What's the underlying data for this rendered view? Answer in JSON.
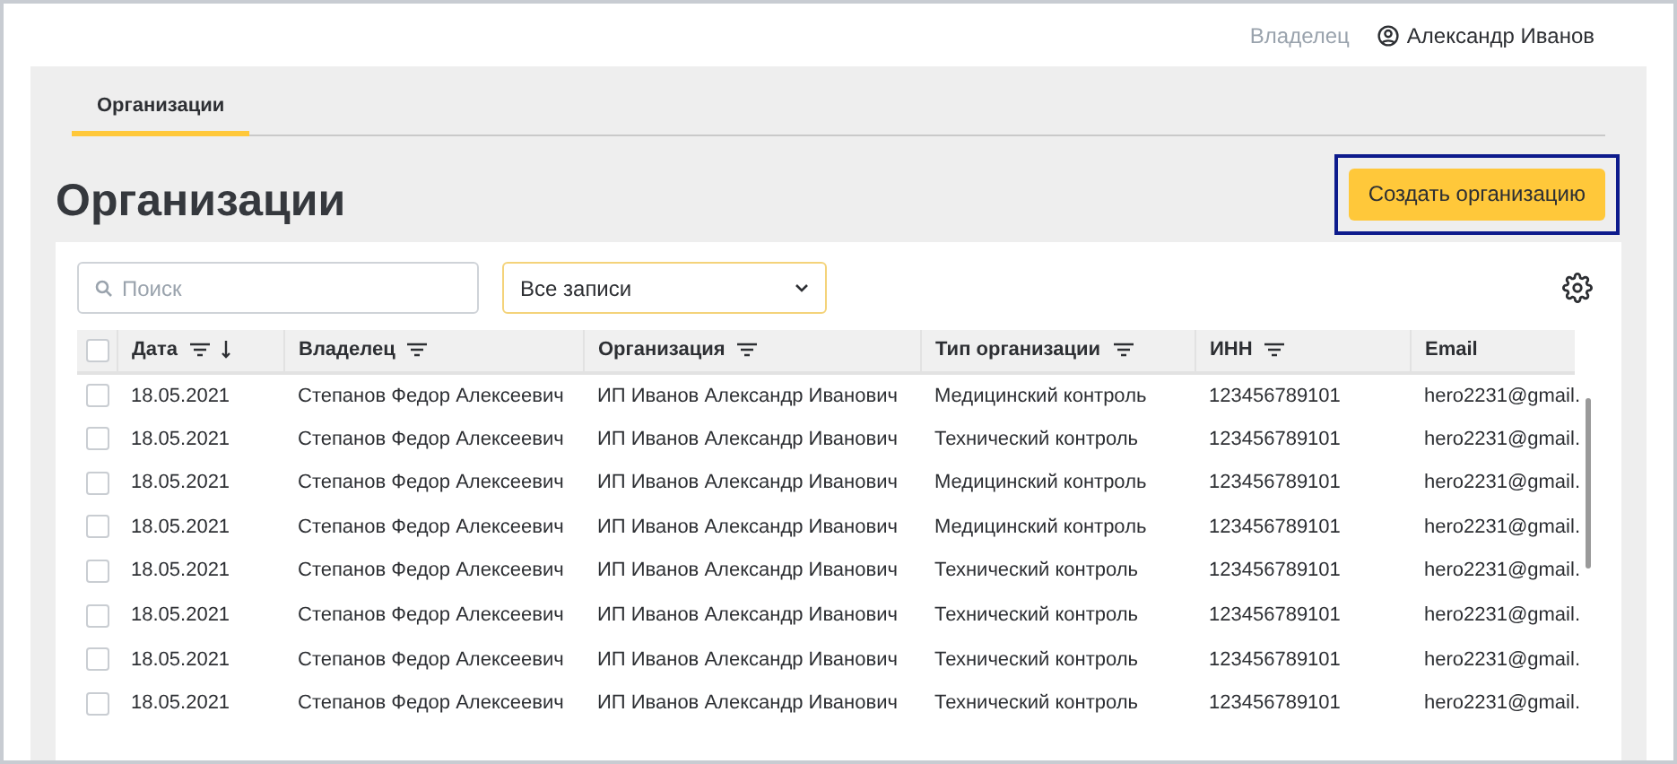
{
  "header": {
    "role": "Владелец",
    "user": "Александр Иванов"
  },
  "tabs": [
    {
      "label": "Организации",
      "selected": true
    }
  ],
  "title": "Организации",
  "create_button": "Создать организацию",
  "search": {
    "placeholder": "Поиск"
  },
  "filter_select": {
    "value": "Все записи"
  },
  "table": {
    "select_all_checked": false,
    "columns": [
      {
        "label": "Дата",
        "filter": true,
        "sorted_descending": true
      },
      {
        "label": "Владелец",
        "filter": true,
        "sorted_descending": false
      },
      {
        "label": "Организация",
        "filter": true,
        "sorted_descending": false
      },
      {
        "label": "Тип организации",
        "filter": true,
        "sorted_descending": false
      },
      {
        "label": "ИНН",
        "filter": true,
        "sorted_descending": false
      },
      {
        "label": "Email",
        "filter": false,
        "sorted_descending": false
      }
    ],
    "rows": [
      {
        "checked": false,
        "cells": [
          "18.05.2021",
          "Степанов Федор Алексеевич",
          "ИП Иванов Александр Иванович",
          "Медицинский контроль",
          "123456789101",
          "hero2231@gmail."
        ]
      },
      {
        "checked": false,
        "cells": [
          "18.05.2021",
          "Степанов Федор Алексеевич",
          "ИП Иванов Александр Иванович",
          "Технический контроль",
          "123456789101",
          "hero2231@gmail."
        ]
      },
      {
        "checked": false,
        "cells": [
          "18.05.2021",
          "Степанов Федор Алексеевич",
          "ИП Иванов Александр Иванович",
          "Медицинский контроль",
          "123456789101",
          "hero2231@gmail."
        ]
      },
      {
        "checked": false,
        "cells": [
          "18.05.2021",
          "Степанов Федор Алексеевич",
          "ИП Иванов Александр Иванович",
          "Медицинский контроль",
          "123456789101",
          "hero2231@gmail."
        ]
      },
      {
        "checked": false,
        "cells": [
          "18.05.2021",
          "Степанов Федор Алексеевич",
          "ИП Иванов Александр Иванович",
          "Технический контроль",
          "123456789101",
          "hero2231@gmail."
        ]
      },
      {
        "checked": false,
        "cells": [
          "18.05.2021",
          "Степанов Федор Алексеевич",
          "ИП Иванов Александр Иванович",
          "Технический контроль",
          "123456789101",
          "hero2231@gmail."
        ]
      },
      {
        "checked": false,
        "cells": [
          "18.05.2021",
          "Степанов Федор Алексеевич",
          "ИП Иванов Александр Иванович",
          "Технический контроль",
          "123456789101",
          "hero2231@gmail."
        ]
      },
      {
        "checked": false,
        "cells": [
          "18.05.2021",
          "Степанов Федор Алексеевич",
          "ИП Иванов Александр Иванович",
          "Технический контроль",
          "123456789101",
          "hero2231@gmail."
        ]
      }
    ]
  }
}
